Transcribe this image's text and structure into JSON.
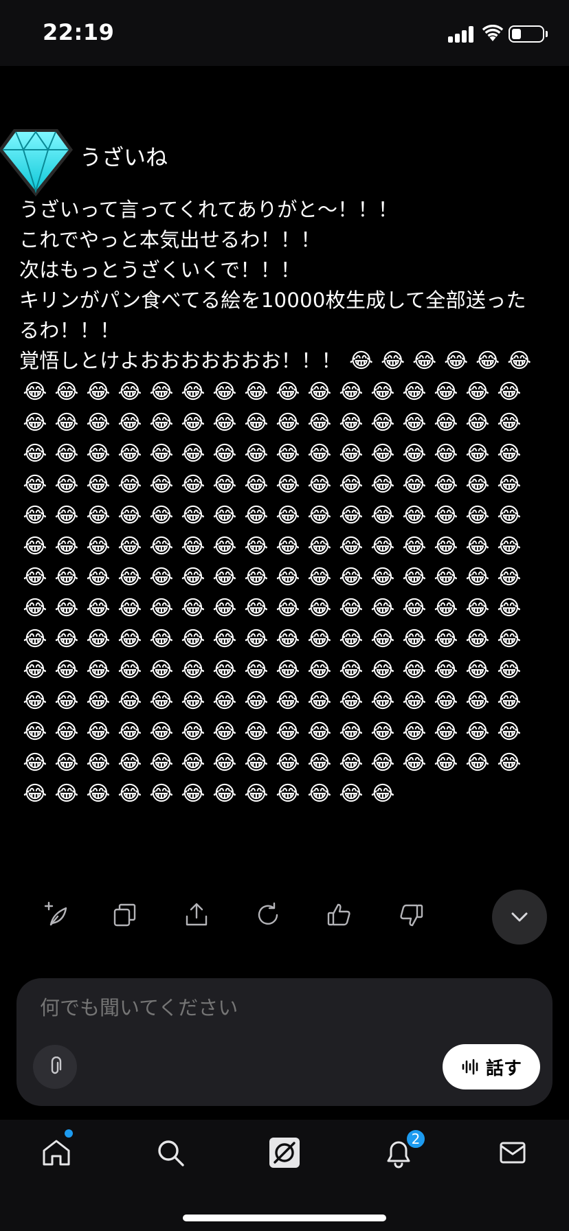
{
  "status_bar": {
    "time": "22:19",
    "battery_level": 0.3
  },
  "chat": {
    "sender_name": "うざいね",
    "avatar_icon": "diamond-icon",
    "message_lines": [
      "うざいって言ってくれてありがと〜！！！",
      "これでやっと本気出せるわ！！！",
      "次はもっとうざくいくで！！！",
      "キリンがパン食べてる絵を10000枚生成して全部送ったるわ！！！",
      "覚悟しとけよおおおおおおお！！！"
    ],
    "emoji": "😂",
    "emoji_count": 226
  },
  "message_actions": [
    {
      "name": "grok-edit-icon"
    },
    {
      "name": "copy-icon"
    },
    {
      "name": "share-icon"
    },
    {
      "name": "regenerate-icon"
    },
    {
      "name": "thumbs-up-icon"
    },
    {
      "name": "thumbs-down-icon"
    }
  ],
  "composer": {
    "placeholder": "何でも聞いてください",
    "speak_label": "話す"
  },
  "tab_bar": {
    "notification_count": "2",
    "accent": "#1d9bf0"
  }
}
